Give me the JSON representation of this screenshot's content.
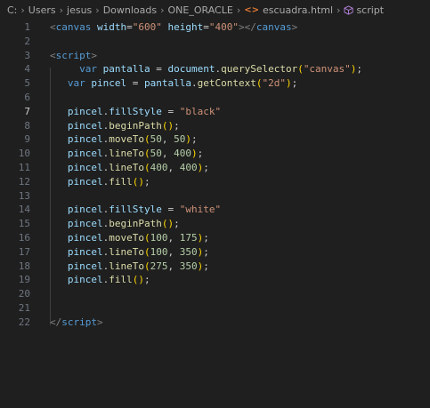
{
  "breadcrumb": {
    "segments": [
      "C:",
      "Users",
      "jesus",
      "Downloads",
      "ONE_ORACLE"
    ],
    "file": "escuadra.html",
    "symbol": "script",
    "file_icon": "html-file-icon",
    "symbol_icon": "cube-symbol-icon"
  },
  "editor": {
    "active_line": 7,
    "lines": [
      {
        "n": "1",
        "tokens": [
          [
            "t-punct",
            "<"
          ],
          [
            "t-tag",
            "canvas"
          ],
          [
            "t-plain",
            " "
          ],
          [
            "t-attr",
            "width"
          ],
          [
            "t-plain",
            "="
          ],
          [
            "t-str",
            "\"600\""
          ],
          [
            "t-plain",
            " "
          ],
          [
            "t-attr",
            "height"
          ],
          [
            "t-plain",
            "="
          ],
          [
            "t-str",
            "\"400\""
          ],
          [
            "t-punct",
            "></"
          ],
          [
            "t-tag",
            "canvas"
          ],
          [
            "t-punct",
            ">"
          ]
        ]
      },
      {
        "n": "2",
        "tokens": []
      },
      {
        "n": "3",
        "tokens": [
          [
            "t-punct",
            "<"
          ],
          [
            "t-tag",
            "script"
          ],
          [
            "t-punct",
            ">"
          ]
        ]
      },
      {
        "n": "4",
        "tokens": [
          [
            "t-plain",
            "     "
          ],
          [
            "t-kw",
            "var"
          ],
          [
            "t-plain",
            " "
          ],
          [
            "t-var",
            "pantalla"
          ],
          [
            "t-plain",
            " = "
          ],
          [
            "t-var",
            "document"
          ],
          [
            "t-plain",
            "."
          ],
          [
            "t-fn",
            "querySelector"
          ],
          [
            "t-brace",
            "("
          ],
          [
            "t-str",
            "\"canvas\""
          ],
          [
            "t-brace",
            ")"
          ],
          [
            "t-plain",
            ";"
          ]
        ]
      },
      {
        "n": "5",
        "tokens": [
          [
            "t-plain",
            "   "
          ],
          [
            "t-kw",
            "var"
          ],
          [
            "t-plain",
            " "
          ],
          [
            "t-var",
            "pincel"
          ],
          [
            "t-plain",
            " = "
          ],
          [
            "t-var",
            "pantalla"
          ],
          [
            "t-plain",
            "."
          ],
          [
            "t-fn",
            "getContext"
          ],
          [
            "t-brace",
            "("
          ],
          [
            "t-str",
            "\"2d\""
          ],
          [
            "t-brace",
            ")"
          ],
          [
            "t-plain",
            ";"
          ]
        ]
      },
      {
        "n": "6",
        "tokens": []
      },
      {
        "n": "7",
        "tokens": [
          [
            "t-plain",
            "   "
          ],
          [
            "t-var",
            "pincel"
          ],
          [
            "t-plain",
            "."
          ],
          [
            "t-var",
            "fillStyle"
          ],
          [
            "t-plain",
            " = "
          ],
          [
            "t-str",
            "\"black\""
          ]
        ]
      },
      {
        "n": "8",
        "tokens": [
          [
            "t-plain",
            "   "
          ],
          [
            "t-var",
            "pincel"
          ],
          [
            "t-plain",
            "."
          ],
          [
            "t-fn",
            "beginPath"
          ],
          [
            "t-brace",
            "()"
          ],
          [
            "t-plain",
            ";"
          ]
        ]
      },
      {
        "n": "9",
        "tokens": [
          [
            "t-plain",
            "   "
          ],
          [
            "t-var",
            "pincel"
          ],
          [
            "t-plain",
            "."
          ],
          [
            "t-fn",
            "moveTo"
          ],
          [
            "t-brace",
            "("
          ],
          [
            "t-num",
            "50"
          ],
          [
            "t-plain",
            ", "
          ],
          [
            "t-num",
            "50"
          ],
          [
            "t-brace",
            ")"
          ],
          [
            "t-plain",
            ";"
          ]
        ]
      },
      {
        "n": "10",
        "tokens": [
          [
            "t-plain",
            "   "
          ],
          [
            "t-var",
            "pincel"
          ],
          [
            "t-plain",
            "."
          ],
          [
            "t-fn",
            "lineTo"
          ],
          [
            "t-brace",
            "("
          ],
          [
            "t-num",
            "50"
          ],
          [
            "t-plain",
            ", "
          ],
          [
            "t-num",
            "400"
          ],
          [
            "t-brace",
            ")"
          ],
          [
            "t-plain",
            ";"
          ]
        ]
      },
      {
        "n": "11",
        "tokens": [
          [
            "t-plain",
            "   "
          ],
          [
            "t-var",
            "pincel"
          ],
          [
            "t-plain",
            "."
          ],
          [
            "t-fn",
            "lineTo"
          ],
          [
            "t-brace",
            "("
          ],
          [
            "t-num",
            "400"
          ],
          [
            "t-plain",
            ", "
          ],
          [
            "t-num",
            "400"
          ],
          [
            "t-brace",
            ")"
          ],
          [
            "t-plain",
            ";"
          ]
        ]
      },
      {
        "n": "12",
        "tokens": [
          [
            "t-plain",
            "   "
          ],
          [
            "t-var",
            "pincel"
          ],
          [
            "t-plain",
            "."
          ],
          [
            "t-fn",
            "fill"
          ],
          [
            "t-brace",
            "()"
          ],
          [
            "t-plain",
            ";"
          ]
        ]
      },
      {
        "n": "13",
        "tokens": []
      },
      {
        "n": "14",
        "tokens": [
          [
            "t-plain",
            "   "
          ],
          [
            "t-var",
            "pincel"
          ],
          [
            "t-plain",
            "."
          ],
          [
            "t-var",
            "fillStyle"
          ],
          [
            "t-plain",
            " = "
          ],
          [
            "t-str",
            "\"white\""
          ]
        ]
      },
      {
        "n": "15",
        "tokens": [
          [
            "t-plain",
            "   "
          ],
          [
            "t-var",
            "pincel"
          ],
          [
            "t-plain",
            "."
          ],
          [
            "t-fn",
            "beginPath"
          ],
          [
            "t-brace",
            "()"
          ],
          [
            "t-plain",
            ";"
          ]
        ]
      },
      {
        "n": "16",
        "tokens": [
          [
            "t-plain",
            "   "
          ],
          [
            "t-var",
            "pincel"
          ],
          [
            "t-plain",
            "."
          ],
          [
            "t-fn",
            "moveTo"
          ],
          [
            "t-brace",
            "("
          ],
          [
            "t-num",
            "100"
          ],
          [
            "t-plain",
            ", "
          ],
          [
            "t-num",
            "175"
          ],
          [
            "t-brace",
            ")"
          ],
          [
            "t-plain",
            ";"
          ]
        ]
      },
      {
        "n": "17",
        "tokens": [
          [
            "t-plain",
            "   "
          ],
          [
            "t-var",
            "pincel"
          ],
          [
            "t-plain",
            "."
          ],
          [
            "t-fn",
            "lineTo"
          ],
          [
            "t-brace",
            "("
          ],
          [
            "t-num",
            "100"
          ],
          [
            "t-plain",
            ", "
          ],
          [
            "t-num",
            "350"
          ],
          [
            "t-brace",
            ")"
          ],
          [
            "t-plain",
            ";"
          ]
        ]
      },
      {
        "n": "18",
        "tokens": [
          [
            "t-plain",
            "   "
          ],
          [
            "t-var",
            "pincel"
          ],
          [
            "t-plain",
            "."
          ],
          [
            "t-fn",
            "lineTo"
          ],
          [
            "t-brace",
            "("
          ],
          [
            "t-num",
            "275"
          ],
          [
            "t-plain",
            ", "
          ],
          [
            "t-num",
            "350"
          ],
          [
            "t-brace",
            ")"
          ],
          [
            "t-plain",
            ";"
          ]
        ]
      },
      {
        "n": "19",
        "tokens": [
          [
            "t-plain",
            "   "
          ],
          [
            "t-var",
            "pincel"
          ],
          [
            "t-plain",
            "."
          ],
          [
            "t-fn",
            "fill"
          ],
          [
            "t-brace",
            "()"
          ],
          [
            "t-plain",
            ";"
          ]
        ]
      },
      {
        "n": "20",
        "tokens": []
      },
      {
        "n": "21",
        "tokens": []
      },
      {
        "n": "22",
        "tokens": [
          [
            "t-punct",
            "</"
          ],
          [
            "t-tag",
            "script"
          ],
          [
            "t-punct",
            ">"
          ]
        ]
      }
    ]
  }
}
